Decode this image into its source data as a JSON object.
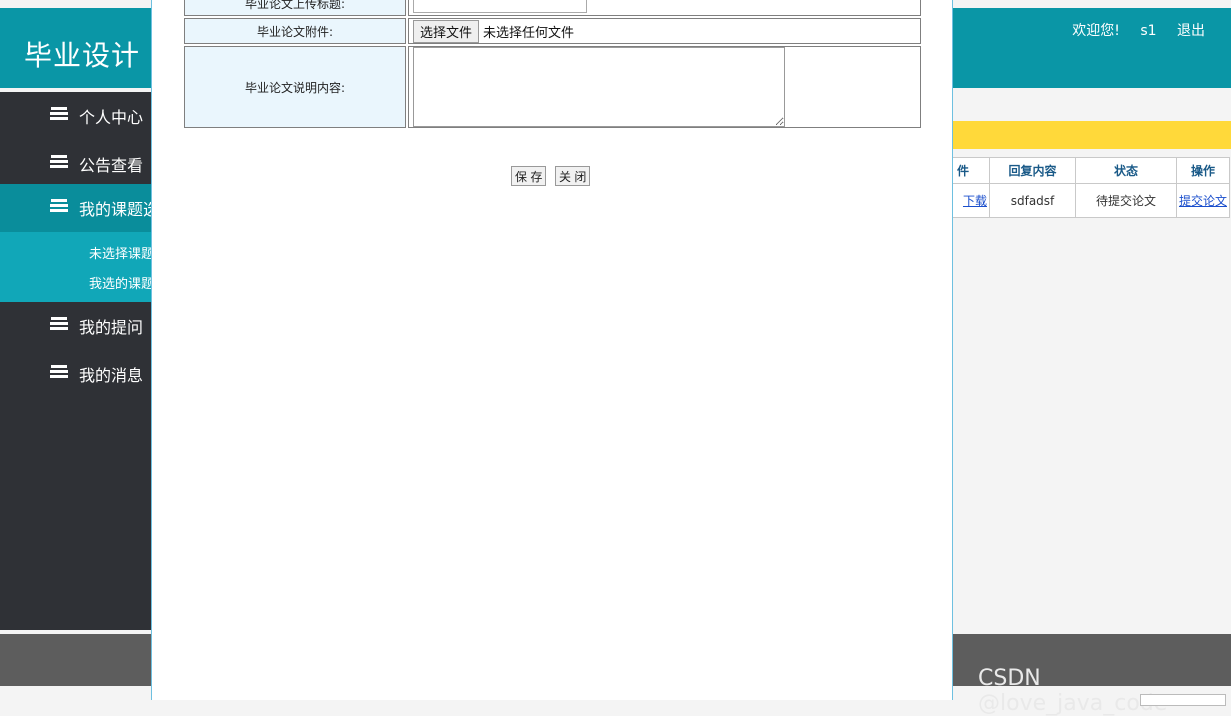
{
  "header": {
    "app_title": "毕业设计",
    "welcome": "欢迎您!",
    "username": "s1",
    "logout": "退出"
  },
  "sidebar": {
    "items": [
      {
        "label": "个人中心"
      },
      {
        "label": "公告查看"
      },
      {
        "label": "我的课题选"
      },
      {
        "label": "我的提问"
      },
      {
        "label": "我的消息"
      }
    ],
    "submenu": [
      {
        "label": "未选择课题"
      },
      {
        "label": "我选的课题"
      }
    ]
  },
  "table": {
    "headers": [
      "件",
      "回复内容",
      "状态",
      "操作"
    ],
    "row": {
      "attachment_link": "下载",
      "reply": "sdfadsf",
      "status": "待提交论文",
      "action_link": "提交论文"
    }
  },
  "modal": {
    "fields": {
      "title_label": "毕业论文上传标题:",
      "attachment_label": "毕业论文附件:",
      "description_label": "毕业论文说明内容:"
    },
    "file_button": "选择文件",
    "file_none": "未选择任何文件",
    "save_button": "保 存",
    "close_button": "关 闭"
  },
  "watermark": "CSDN @love_java_code"
}
